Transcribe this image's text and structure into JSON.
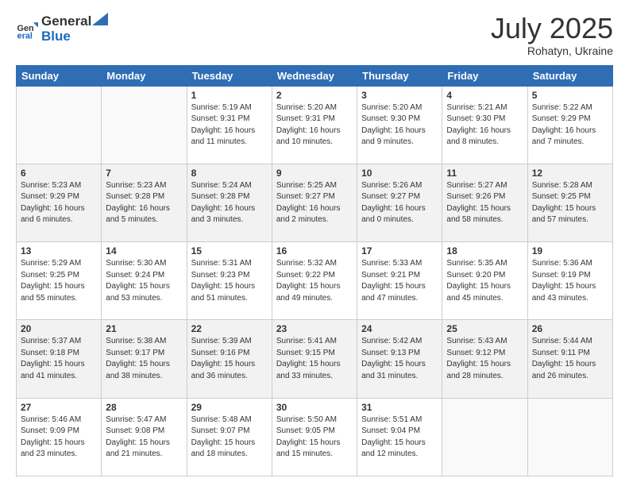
{
  "header": {
    "logo_general": "General",
    "logo_blue": "Blue",
    "title": "July 2025",
    "location": "Rohatyn, Ukraine"
  },
  "weekdays": [
    "Sunday",
    "Monday",
    "Tuesday",
    "Wednesday",
    "Thursday",
    "Friday",
    "Saturday"
  ],
  "weeks": [
    [
      {
        "day": "",
        "info": ""
      },
      {
        "day": "",
        "info": ""
      },
      {
        "day": "1",
        "info": "Sunrise: 5:19 AM\nSunset: 9:31 PM\nDaylight: 16 hours and 11 minutes."
      },
      {
        "day": "2",
        "info": "Sunrise: 5:20 AM\nSunset: 9:31 PM\nDaylight: 16 hours and 10 minutes."
      },
      {
        "day": "3",
        "info": "Sunrise: 5:20 AM\nSunset: 9:30 PM\nDaylight: 16 hours and 9 minutes."
      },
      {
        "day": "4",
        "info": "Sunrise: 5:21 AM\nSunset: 9:30 PM\nDaylight: 16 hours and 8 minutes."
      },
      {
        "day": "5",
        "info": "Sunrise: 5:22 AM\nSunset: 9:29 PM\nDaylight: 16 hours and 7 minutes."
      }
    ],
    [
      {
        "day": "6",
        "info": "Sunrise: 5:23 AM\nSunset: 9:29 PM\nDaylight: 16 hours and 6 minutes."
      },
      {
        "day": "7",
        "info": "Sunrise: 5:23 AM\nSunset: 9:28 PM\nDaylight: 16 hours and 5 minutes."
      },
      {
        "day": "8",
        "info": "Sunrise: 5:24 AM\nSunset: 9:28 PM\nDaylight: 16 hours and 3 minutes."
      },
      {
        "day": "9",
        "info": "Sunrise: 5:25 AM\nSunset: 9:27 PM\nDaylight: 16 hours and 2 minutes."
      },
      {
        "day": "10",
        "info": "Sunrise: 5:26 AM\nSunset: 9:27 PM\nDaylight: 16 hours and 0 minutes."
      },
      {
        "day": "11",
        "info": "Sunrise: 5:27 AM\nSunset: 9:26 PM\nDaylight: 15 hours and 58 minutes."
      },
      {
        "day": "12",
        "info": "Sunrise: 5:28 AM\nSunset: 9:25 PM\nDaylight: 15 hours and 57 minutes."
      }
    ],
    [
      {
        "day": "13",
        "info": "Sunrise: 5:29 AM\nSunset: 9:25 PM\nDaylight: 15 hours and 55 minutes."
      },
      {
        "day": "14",
        "info": "Sunrise: 5:30 AM\nSunset: 9:24 PM\nDaylight: 15 hours and 53 minutes."
      },
      {
        "day": "15",
        "info": "Sunrise: 5:31 AM\nSunset: 9:23 PM\nDaylight: 15 hours and 51 minutes."
      },
      {
        "day": "16",
        "info": "Sunrise: 5:32 AM\nSunset: 9:22 PM\nDaylight: 15 hours and 49 minutes."
      },
      {
        "day": "17",
        "info": "Sunrise: 5:33 AM\nSunset: 9:21 PM\nDaylight: 15 hours and 47 minutes."
      },
      {
        "day": "18",
        "info": "Sunrise: 5:35 AM\nSunset: 9:20 PM\nDaylight: 15 hours and 45 minutes."
      },
      {
        "day": "19",
        "info": "Sunrise: 5:36 AM\nSunset: 9:19 PM\nDaylight: 15 hours and 43 minutes."
      }
    ],
    [
      {
        "day": "20",
        "info": "Sunrise: 5:37 AM\nSunset: 9:18 PM\nDaylight: 15 hours and 41 minutes."
      },
      {
        "day": "21",
        "info": "Sunrise: 5:38 AM\nSunset: 9:17 PM\nDaylight: 15 hours and 38 minutes."
      },
      {
        "day": "22",
        "info": "Sunrise: 5:39 AM\nSunset: 9:16 PM\nDaylight: 15 hours and 36 minutes."
      },
      {
        "day": "23",
        "info": "Sunrise: 5:41 AM\nSunset: 9:15 PM\nDaylight: 15 hours and 33 minutes."
      },
      {
        "day": "24",
        "info": "Sunrise: 5:42 AM\nSunset: 9:13 PM\nDaylight: 15 hours and 31 minutes."
      },
      {
        "day": "25",
        "info": "Sunrise: 5:43 AM\nSunset: 9:12 PM\nDaylight: 15 hours and 28 minutes."
      },
      {
        "day": "26",
        "info": "Sunrise: 5:44 AM\nSunset: 9:11 PM\nDaylight: 15 hours and 26 minutes."
      }
    ],
    [
      {
        "day": "27",
        "info": "Sunrise: 5:46 AM\nSunset: 9:09 PM\nDaylight: 15 hours and 23 minutes."
      },
      {
        "day": "28",
        "info": "Sunrise: 5:47 AM\nSunset: 9:08 PM\nDaylight: 15 hours and 21 minutes."
      },
      {
        "day": "29",
        "info": "Sunrise: 5:48 AM\nSunset: 9:07 PM\nDaylight: 15 hours and 18 minutes."
      },
      {
        "day": "30",
        "info": "Sunrise: 5:50 AM\nSunset: 9:05 PM\nDaylight: 15 hours and 15 minutes."
      },
      {
        "day": "31",
        "info": "Sunrise: 5:51 AM\nSunset: 9:04 PM\nDaylight: 15 hours and 12 minutes."
      },
      {
        "day": "",
        "info": ""
      },
      {
        "day": "",
        "info": ""
      }
    ]
  ]
}
